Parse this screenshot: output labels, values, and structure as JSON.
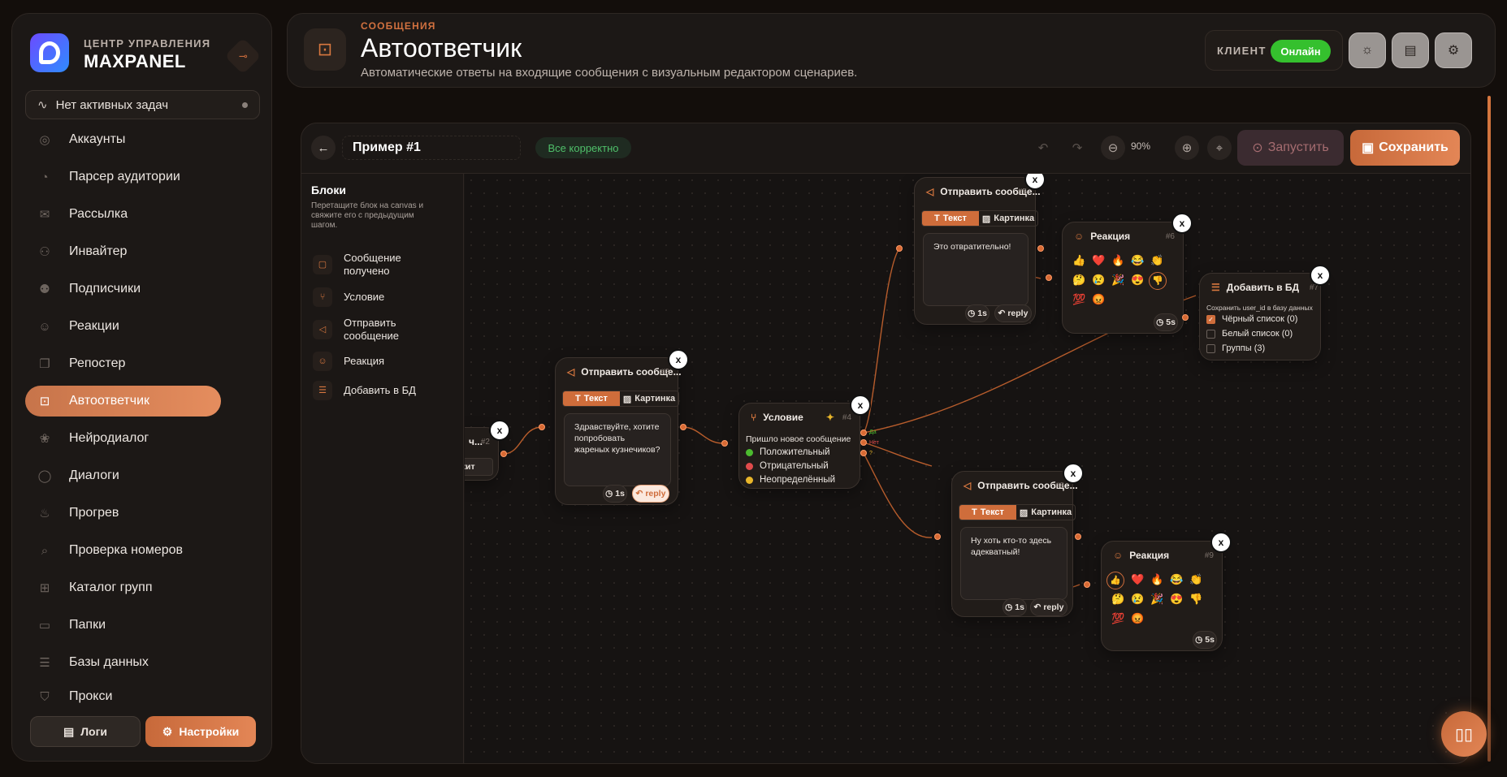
{
  "brand": {
    "subtitle": "ЦЕНТР УПРАВЛЕНИЯ",
    "name": "MAXPANEL"
  },
  "tasks": {
    "label": "Нет активных задач"
  },
  "nav": [
    {
      "label": "Аккаунты",
      "icon": "user-circle-icon"
    },
    {
      "label": "Парсер аудитории",
      "icon": "gauge-icon"
    },
    {
      "label": "Рассылка",
      "icon": "mail-icon"
    },
    {
      "label": "Инвайтер",
      "icon": "user-plus-icon"
    },
    {
      "label": "Подписчики",
      "icon": "users-icon"
    },
    {
      "label": "Реакции",
      "icon": "smile-icon"
    },
    {
      "label": "Репостер",
      "icon": "copy-icon"
    },
    {
      "label": "Автоответчик",
      "icon": "robot-icon",
      "active": true
    },
    {
      "label": "Нейродиалог",
      "icon": "brain-icon"
    },
    {
      "label": "Диалоги",
      "icon": "chat-bubble-icon"
    },
    {
      "label": "Прогрев",
      "icon": "flame-icon"
    },
    {
      "label": "Проверка номеров",
      "icon": "phone-search-icon"
    },
    {
      "label": "Каталог групп",
      "icon": "grid-icon"
    },
    {
      "label": "Папки",
      "icon": "folder-icon"
    },
    {
      "label": "Базы данных",
      "icon": "database-icon"
    },
    {
      "label": "Прокси",
      "icon": "shield-icon"
    }
  ],
  "footer": {
    "logs": "Логи",
    "settings": "Настройки"
  },
  "header": {
    "kicker": "СООБЩЕНИЯ",
    "title": "Автоответчик",
    "subtitle": "Автоматические ответы на входящие сообщения с визуальным редактором сценариев.",
    "client_label": "КЛИЕНТ",
    "client_status": "Онлайн",
    "status_color": "#35c02e"
  },
  "editor": {
    "scenario_name": "Пример #1",
    "validation": "Все корректно",
    "zoom": "90%",
    "run_label": "Запустить",
    "save_label": "Сохранить"
  },
  "blocks_panel": {
    "title": "Блоки",
    "description": "Перетащите блок на canvas и свяжите его с предыдущим шагом.",
    "items": [
      "Сообщение получено",
      "Условие",
      "Отправить сообщение",
      "Реакция",
      "Добавить в БД"
    ]
  },
  "nodes": {
    "n2": {
      "id": "#2",
      "title": "ч...",
      "button": "ржит"
    },
    "n3": {
      "id": "#3",
      "title": "Отправить сообще...",
      "tab_text": "Текст",
      "tab_image": "Картинка",
      "text": "Здравствуйте, хотите попробовать жареных кузнечиков?",
      "delay": "1s",
      "reply": "reply"
    },
    "n4": {
      "id": "#4",
      "title": "Условие",
      "trigger": "Пришло новое сообщение",
      "options": [
        {
          "label": "Положительный",
          "color": "#4cbb2f"
        },
        {
          "label": "Отрицательный",
          "color": "#e04b4b"
        },
        {
          "label": "Неопределённый",
          "color": "#e9b62a"
        }
      ],
      "out_yes": "Да",
      "out_no": "Нет",
      "out_unknown": "?"
    },
    "n5": {
      "id": "#5",
      "title": "Отправить сообще...",
      "tab_text": "Текст",
      "tab_image": "Картинка",
      "text": "Это отвратительно!",
      "delay": "1s",
      "reply": "reply"
    },
    "n6": {
      "id": "#6",
      "title": "Реакция",
      "delay": "5s"
    },
    "n7": {
      "id": "#7",
      "title": "Добавить в БД",
      "desc": "Сохранить user_id в базу данных",
      "lists": [
        "Чёрный список (0)",
        "Белый список (0)",
        "Группы (3)"
      ]
    },
    "n8": {
      "id": "#8",
      "title": "Отправить сообще...",
      "tab_text": "Текст",
      "tab_image": "Картинка",
      "text": "Ну хоть кто-то здесь адекватный!",
      "delay": "1s",
      "reply": "reply"
    },
    "n9": {
      "id": "#9",
      "title": "Реакция",
      "delay": "5s"
    }
  },
  "reactions": [
    "👍",
    "❤️",
    "🔥",
    "😂",
    "👏",
    "🤔",
    "😢",
    "🎉",
    "😍",
    "👎",
    "💯",
    "😡"
  ],
  "accent_color": "#d7773f"
}
